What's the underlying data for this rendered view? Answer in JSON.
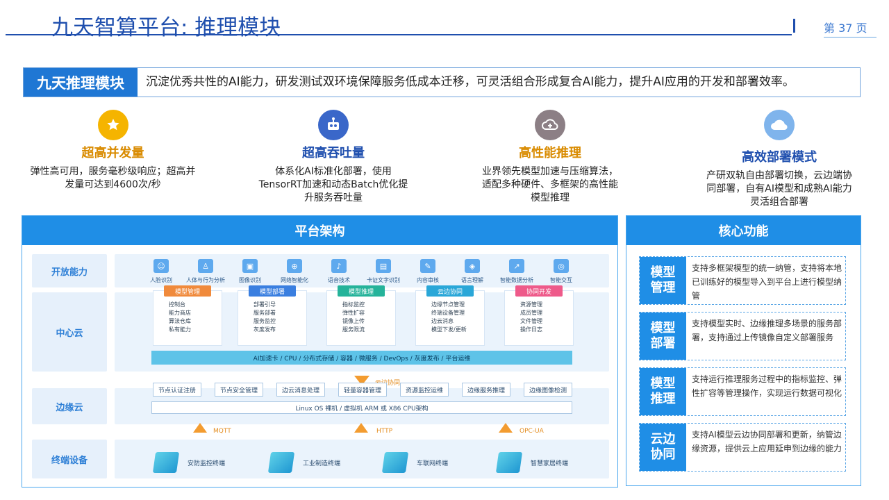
{
  "header": {
    "title": "九天智算平台: 推理模块",
    "page": "第 37 页"
  },
  "banner": {
    "tag": "九天推理模块",
    "text": "沉淀优秀共性的AI能力，研发测试双环境保障服务低成本迁移，可灵活组合形成复合AI能力，提升AI应用的开发和部署效率。"
  },
  "features": [
    {
      "title": "超高并发量",
      "desc": "弹性高可用，服务毫秒级响应；超高并发量可达到4600次/秒",
      "icon": "star-badge-icon",
      "color": "#f5b400",
      "title_color": "#d98b00"
    },
    {
      "title": "超高吞吐量",
      "desc": "体系化AI标准化部署，使用TensorRT加速和动态Batch优化提升服务吞吐量",
      "icon": "robot-icon",
      "color": "#3a67c9",
      "title_color": "#1f4fae"
    },
    {
      "title": "高性能推理",
      "desc": "业界领先模型加速与压缩算法，适配多种硬件、多框架的高性能模型推理",
      "icon": "cloud-sync-icon",
      "color": "#8c7f85",
      "title_color": "#d98b00"
    },
    {
      "title": "高效部署模式",
      "desc": "产研双轨自由部署切换，云边端协同部署，自有AI模型和成熟AI能力灵活组合部署",
      "icon": "cloud-icon",
      "color": "#7fb4ec",
      "title_color": "#1f4fae"
    }
  ],
  "arch": {
    "title": "平台架构",
    "rows": [
      "开放能力",
      "中心云",
      "边缘云",
      "终端设备"
    ],
    "capabilities": [
      "人脸识别",
      "人体与行为分析",
      "图像识别",
      "网络智能化",
      "语音技术",
      "卡证文字识别",
      "内容审核",
      "语言理解",
      "智能数据分析",
      "智能交互"
    ],
    "modules": [
      {
        "title": "模型管理",
        "color": "#f08a3c",
        "items": [
          "控制台",
          "能力商店",
          "算法仓库",
          "私有能力"
        ]
      },
      {
        "title": "模型部署",
        "color": "#3a7fe0",
        "items": [
          "部署引导",
          "服务部署",
          "服务监控",
          "灰度发布"
        ]
      },
      {
        "title": "模型推理",
        "color": "#25b39a",
        "items": [
          "指标监控",
          "弹性扩容",
          "镜像上传",
          "服务限流"
        ]
      },
      {
        "title": "云边协同",
        "color": "#2aa7d8",
        "items": [
          "边缘节点管理",
          "终端设备管理",
          "边云消息",
          "模型下发/更新"
        ]
      },
      {
        "title": "协同开发",
        "color": "#ee5a8a",
        "items": [
          "资源管理",
          "成员管理",
          "文件管理",
          "操作日志"
        ]
      }
    ],
    "infra": "AI加速卡  /  CPU  /  分布式存储  /  容器  /  微服务  /  DevOps  /  灰度发布  /  平台运维",
    "sync": "云边协同",
    "edge": [
      "节点认证注册",
      "节点安全管理",
      "边云消息处理",
      "轻量容器管理",
      "资源监控运维",
      "边缘服务推理",
      "边缘图像检测"
    ],
    "os": "Linux OS 裸机   /   虚拟机 ARM 或 X86 CPU架构",
    "protocols": [
      "MQTT",
      "HTTP",
      "OPC-UA"
    ],
    "devices": [
      "安防监控终端",
      "工业制造终端",
      "车联网终端",
      "智慧家居终端"
    ]
  },
  "core": {
    "title": "核心功能",
    "items": [
      {
        "tag": "模型\n管理",
        "desc": "支持多框架模型的统一纳管，支持将本地已训练好的模型导入到平台上进行模型纳管"
      },
      {
        "tag": "模型\n部署",
        "desc": "支持模型实时、边缘推理多场景的服务部署，支持通过上传镜像自定义部署服务"
      },
      {
        "tag": "模型\n推理",
        "desc": "支持运行推理服务过程中的指标监控、弹性扩容等管理操作，实现运行数据可视化"
      },
      {
        "tag": "云边\n协同",
        "desc": "支持AI模型云边协同部署和更新，纳管边缘资源，提供云上应用延申到边缘的能力"
      }
    ]
  }
}
